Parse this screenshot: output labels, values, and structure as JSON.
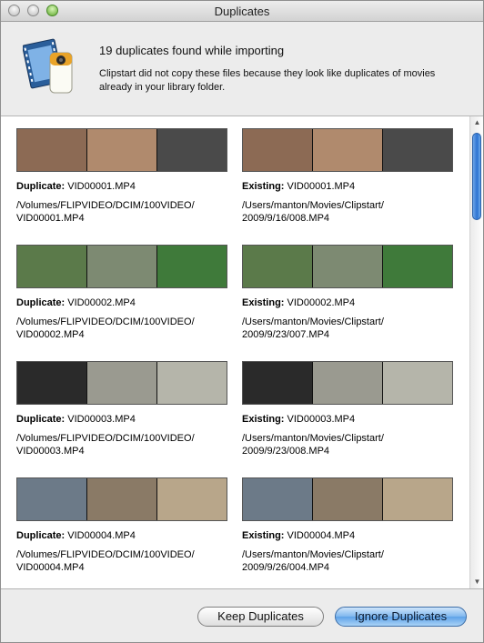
{
  "window": {
    "title": "Duplicates"
  },
  "header": {
    "headline": "19 duplicates found while importing",
    "subtext": "Clipstart did not copy these files because they look like duplicates of movies already in your library folder.",
    "icon": "clipstart-app-icon"
  },
  "colors": {
    "accent": "#5ea2e8",
    "window_bg": "#ececec"
  },
  "rows": [
    {
      "duplicate_prefix": "Duplicate:",
      "duplicate_name": "VID00001.MP4",
      "duplicate_path": "/Volumes/FLIPVIDEO/DCIM/100VIDEO/\nVID00001.MP4",
      "existing_prefix": "Existing:",
      "existing_name": "VID00001.MP4",
      "existing_path": "/Users/manton/Movies/Clipstart/\n2009/9/16/008.MP4",
      "frames": [
        "#8c6a54",
        "#b08a6d",
        "#4a4a4a"
      ]
    },
    {
      "duplicate_prefix": "Duplicate:",
      "duplicate_name": "VID00002.MP4",
      "duplicate_path": "/Volumes/FLIPVIDEO/DCIM/100VIDEO/\nVID00002.MP4",
      "existing_prefix": "Existing:",
      "existing_name": "VID00002.MP4",
      "existing_path": "/Users/manton/Movies/Clipstart/\n2009/9/23/007.MP4",
      "frames": [
        "#5b7a4a",
        "#7d8a72",
        "#3f7a3a"
      ]
    },
    {
      "duplicate_prefix": "Duplicate:",
      "duplicate_name": "VID00003.MP4",
      "duplicate_path": "/Volumes/FLIPVIDEO/DCIM/100VIDEO/\nVID00003.MP4",
      "existing_prefix": "Existing:",
      "existing_name": "VID00003.MP4",
      "existing_path": "/Users/manton/Movies/Clipstart/\n2009/9/23/008.MP4",
      "frames": [
        "#2a2a2a",
        "#9a9a90",
        "#b5b5aa"
      ]
    },
    {
      "duplicate_prefix": "Duplicate:",
      "duplicate_name": "VID00004.MP4",
      "duplicate_path": "/Volumes/FLIPVIDEO/DCIM/100VIDEO/\nVID00004.MP4",
      "existing_prefix": "Existing:",
      "existing_name": "VID00004.MP4",
      "existing_path": "/Users/manton/Movies/Clipstart/\n2009/9/26/004.MP4",
      "frames": [
        "#6c7a88",
        "#8a7a66",
        "#b8a68a"
      ]
    }
  ],
  "footer": {
    "keep_label": "Keep Duplicates",
    "ignore_label": "Ignore Duplicates"
  }
}
